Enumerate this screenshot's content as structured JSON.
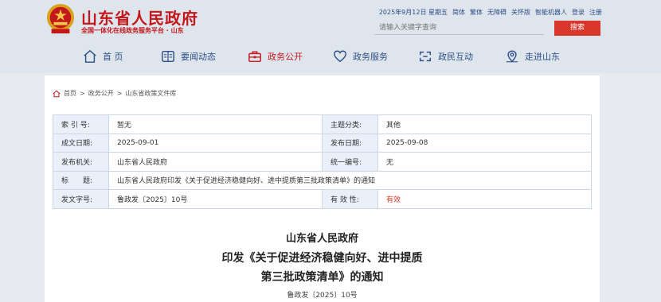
{
  "header": {
    "site_name": "山东省人民政府",
    "site_sub": "全国一体化在线政务服务平台 · 山东",
    "date": "2025年9月12日 星期五",
    "links": [
      "简体",
      "繁体",
      "无障碍",
      "关怀版",
      "智能机器人",
      "登录",
      "注册"
    ],
    "search_placeholder": "请输入关键字查询",
    "search_label": "搜索"
  },
  "nav": [
    {
      "label": "首 页",
      "icon": "home-icon"
    },
    {
      "label": "要闻动态",
      "icon": "news-icon"
    },
    {
      "label": "政务公开",
      "icon": "briefcase-icon",
      "active": true
    },
    {
      "label": "政务服务",
      "icon": "heart-icon"
    },
    {
      "label": "政民互动",
      "icon": "interaction-icon"
    },
    {
      "label": "走进山东",
      "icon": "location-icon"
    }
  ],
  "breadcrumb": {
    "items": [
      "首页",
      "政务公开",
      "山东省政策文件库"
    ],
    "separator": ">"
  },
  "meta": {
    "index_label": "索 引 号:",
    "index_value": "暂无",
    "topic_label": "主题分类:",
    "topic_value": "其他",
    "written_label": "成文日期:",
    "written_value": "2025-09-01",
    "published_label": "发布日期:",
    "published_value": "2025-09-08",
    "issuer_label": "发布机关:",
    "issuer_value": "山东省人民政府",
    "unified_label": "统一编号:",
    "unified_value": "无",
    "title_label": "标　　题:",
    "title_value": "山东省人民政府印发《关于促进经济稳健向好、进中提质第三批政策清单》的通知",
    "docno_label": "发文字号:",
    "docno_value": "鲁政发〔2025〕10号",
    "validity_label": "有 效 性:",
    "validity_value": "有效"
  },
  "doc_title": {
    "line1": "山东省人民政府",
    "line2": "印发《关于促进经济稳健向好、进中提质",
    "line3": "第三批政策清单》的通知",
    "docno": "鲁政发〔2025〕10号"
  },
  "colors": {
    "brand_red": "#c2171b",
    "nav_blue": "#2d4f86",
    "validity_red": "#d43c2c"
  }
}
